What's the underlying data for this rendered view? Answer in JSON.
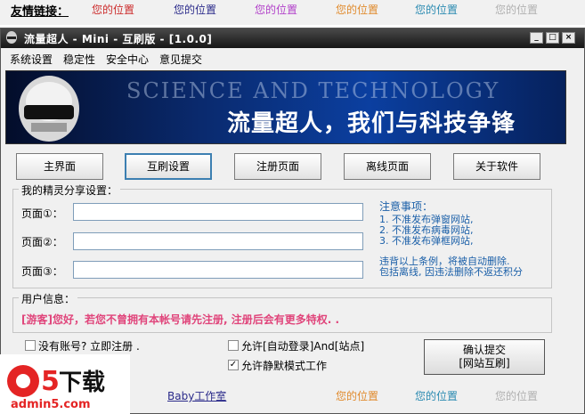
{
  "linkbar": {
    "label": "友情链接：",
    "links": [
      {
        "text": "您的位置",
        "color": "#cc2b2b"
      },
      {
        "text": "您的位置",
        "color": "#2a2a8a"
      },
      {
        "text": "您的位置",
        "color": "#b13fc9"
      },
      {
        "text": "您的位置",
        "color": "#e08a2c"
      },
      {
        "text": "您的位置",
        "color": "#2a8ab1"
      },
      {
        "text": "您的位置",
        "color": "#b0b0b0"
      }
    ]
  },
  "window": {
    "title": "流量超人 - Mini - 互刷版 - [1.0.0]",
    "controls": {
      "minimize": "_",
      "maximize": "□",
      "close": "×"
    }
  },
  "menu": [
    "系统设置",
    "稳定性",
    "安全中心",
    "意见提交"
  ],
  "banner": {
    "watermark": "SCIENCE AND TECHNOLOGY",
    "slogan": "流量超人，我们与科技争锋"
  },
  "nav": [
    "主界面",
    "互刷设置",
    "注册页面",
    "离线页面",
    "关于软件"
  ],
  "share": {
    "title": "我的精灵分享设置：",
    "fields": [
      {
        "label": "页面①：",
        "value": ""
      },
      {
        "label": "页面②：",
        "value": ""
      },
      {
        "label": "页面③：",
        "value": ""
      }
    ],
    "notice_title": "注意事项：",
    "notice": [
      "1. 不准发布弹窗网站,",
      "2. 不准发布病毒网站,",
      "3. 不准发布弹框网站,"
    ],
    "violation": [
      "违背以上条例，将被自动删除.",
      "包括离线, 因违法删除不返还积分"
    ]
  },
  "user": {
    "title": "用户信息：",
    "message": "[游客]您好，若您不曾拥有本帐号请先注册, 注册后会有更多特权. ."
  },
  "options": {
    "register": {
      "label": "没有账号? 立即注册 .",
      "checked": false
    },
    "auto_login": {
      "label": "允许[自动登录]And[站点]",
      "checked": false
    },
    "silent": {
      "label": "允许静默模式工作",
      "checked": true
    },
    "check_mark": "✓"
  },
  "submit": {
    "line1": "确认提交",
    "line2": "[网站互刷]"
  },
  "bottom": [
    {
      "text": "Baby工作室",
      "color": "#2a2a8a"
    },
    {
      "text": "您的位置",
      "color": "#e08a2c"
    },
    {
      "text": "您的位置",
      "color": "#2a8ab1"
    },
    {
      "text": "您的位置",
      "color": "#b0b0b0"
    }
  ],
  "watermark_logo": {
    "big": "a5下载",
    "site": "admin5.com"
  }
}
